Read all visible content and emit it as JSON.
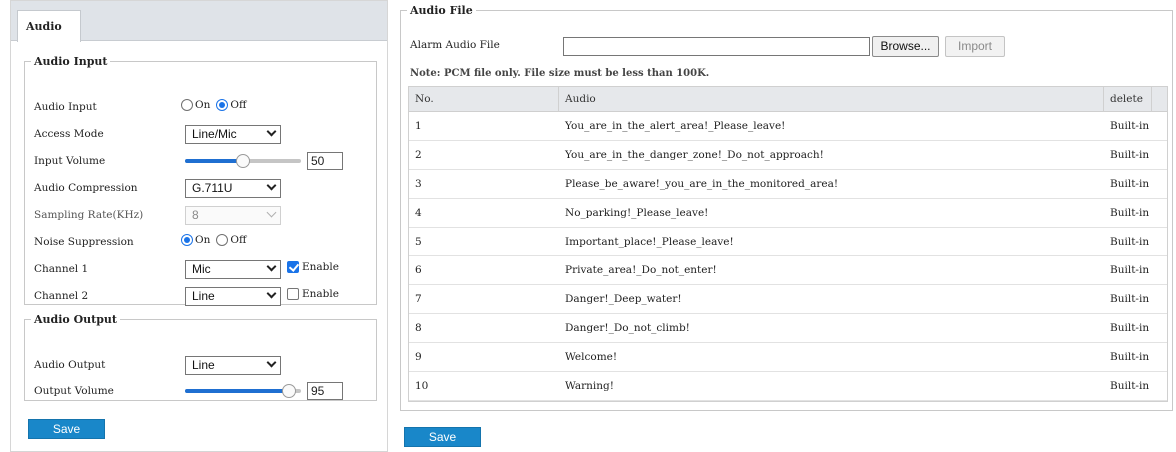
{
  "left": {
    "tab_label": "Audio",
    "audio_input": {
      "legend": "Audio Input",
      "rows": {
        "audio_input": {
          "label": "Audio Input",
          "on": "On",
          "off": "Off",
          "selected": "Off"
        },
        "access_mode": {
          "label": "Access Mode",
          "value": "Line/Mic"
        },
        "input_volume": {
          "label": "Input Volume",
          "value": "50",
          "level": 0.5
        },
        "audio_compression": {
          "label": "Audio Compression",
          "value": "G.711U"
        },
        "sampling_rate": {
          "label": "Sampling Rate(KHz)",
          "value": "8"
        },
        "noise_suppression": {
          "label": "Noise Suppression",
          "on": "On",
          "off": "Off",
          "selected": "On"
        },
        "channel1": {
          "label": "Channel 1",
          "value": "Mic",
          "enable_label": "Enable",
          "enabled": true
        },
        "channel2": {
          "label": "Channel 2",
          "value": "Line",
          "enable_label": "Enable",
          "enabled": false
        }
      }
    },
    "audio_output": {
      "legend": "Audio Output",
      "rows": {
        "audio_output": {
          "label": "Audio Output",
          "value": "Line"
        },
        "output_volume": {
          "label": "Output Volume",
          "value": "95",
          "level": 0.95
        }
      }
    },
    "save_label": "Save"
  },
  "right": {
    "legend": "Audio File",
    "alarm_label": "Alarm Audio File",
    "alarm_value": "",
    "browse_label": "Browse...",
    "import_label": "Import",
    "note": "Note: PCM file only. File size must be less than 100K.",
    "table": {
      "headers": {
        "no": "No.",
        "audio": "Audio",
        "delete": "delete"
      },
      "rows": [
        {
          "no": "1",
          "audio": "You_are_in_the_alert_area!_Please_leave!",
          "delete": "Built-in"
        },
        {
          "no": "2",
          "audio": "You_are_in_the_danger_zone!_Do_not_approach!",
          "delete": "Built-in"
        },
        {
          "no": "3",
          "audio": "Please_be_aware!_you_are_in_the_monitored_area!",
          "delete": "Built-in"
        },
        {
          "no": "4",
          "audio": "No_parking!_Please_leave!",
          "delete": "Built-in"
        },
        {
          "no": "5",
          "audio": "Important_place!_Please_leave!",
          "delete": "Built-in"
        },
        {
          "no": "6",
          "audio": "Private_area!_Do_not_enter!",
          "delete": "Built-in"
        },
        {
          "no": "7",
          "audio": "Danger!_Deep_water!",
          "delete": "Built-in"
        },
        {
          "no": "8",
          "audio": "Danger!_Do_not_climb!",
          "delete": "Built-in"
        },
        {
          "no": "9",
          "audio": "Welcome!",
          "delete": "Built-in"
        },
        {
          "no": "10",
          "audio": "Warning!",
          "delete": "Built-in"
        }
      ]
    },
    "save_label": "Save"
  }
}
